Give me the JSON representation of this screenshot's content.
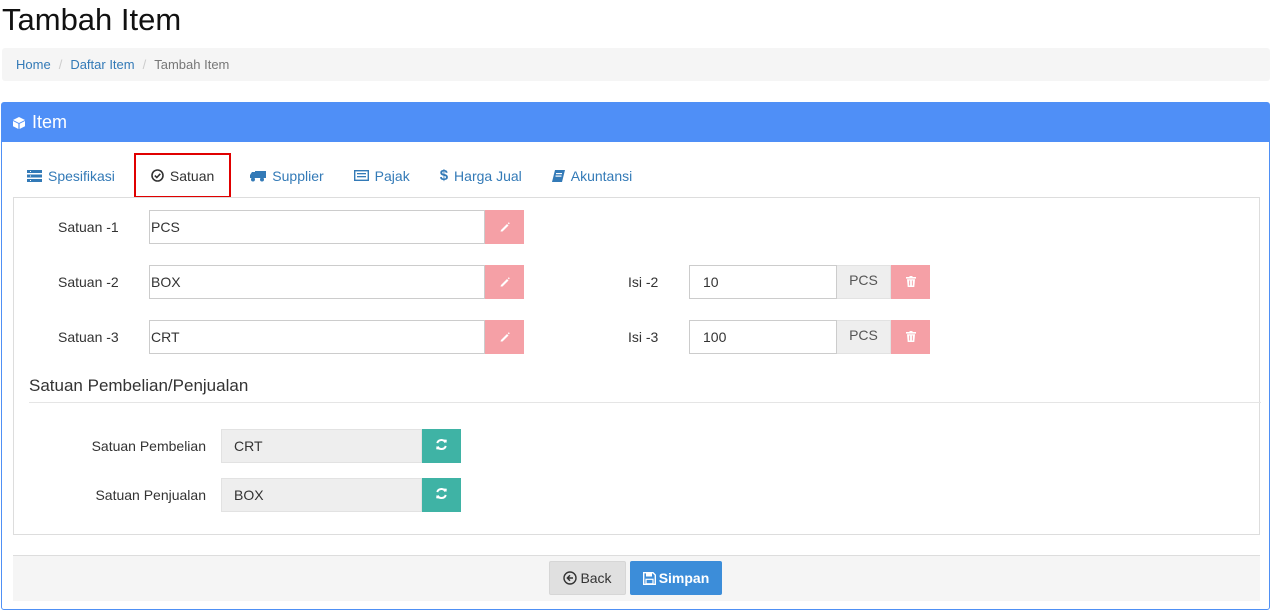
{
  "page": {
    "title": "Tambah Item"
  },
  "breadcrumb": {
    "home": "Home",
    "list": "Daftar Item",
    "current": "Tambah Item",
    "separator": "/"
  },
  "panel": {
    "title": "Item",
    "icon": "cube-icon"
  },
  "tabs": [
    {
      "label": "Spesifikasi",
      "icon": "list-icon"
    },
    {
      "label": "Satuan",
      "icon": "check-circle-icon",
      "active": true
    },
    {
      "label": "Supplier",
      "icon": "truck-icon"
    },
    {
      "label": "Pajak",
      "icon": "card-icon"
    },
    {
      "label": "Harga Jual",
      "icon": "dollar-icon"
    },
    {
      "label": "Akuntansi",
      "icon": "book-icon"
    }
  ],
  "units": {
    "satuan1": {
      "label": "Satuan -1",
      "value": "PCS"
    },
    "satuan2": {
      "label": "Satuan -2",
      "value": "BOX",
      "isi_label": "Isi -2",
      "isi_value": "10",
      "isi_unit": "PCS"
    },
    "satuan3": {
      "label": "Satuan -3",
      "value": "CRT",
      "isi_label": "Isi -3",
      "isi_value": "100",
      "isi_unit": "PCS"
    }
  },
  "purchase_sale": {
    "title": "Satuan Pembelian/Penjualan",
    "pembelian": {
      "label": "Satuan Pembelian",
      "value": "CRT"
    },
    "penjualan": {
      "label": "Satuan Penjualan",
      "value": "BOX"
    }
  },
  "footer": {
    "back_label": "Back",
    "save_label": "Simpan"
  },
  "colors": {
    "header_blue": "#4f8ff7",
    "edit_pink": "#f5a0a6",
    "refresh_teal": "#3fb3a5",
    "save_blue": "#3c8dd9",
    "active_tab_border": "#e00000"
  }
}
